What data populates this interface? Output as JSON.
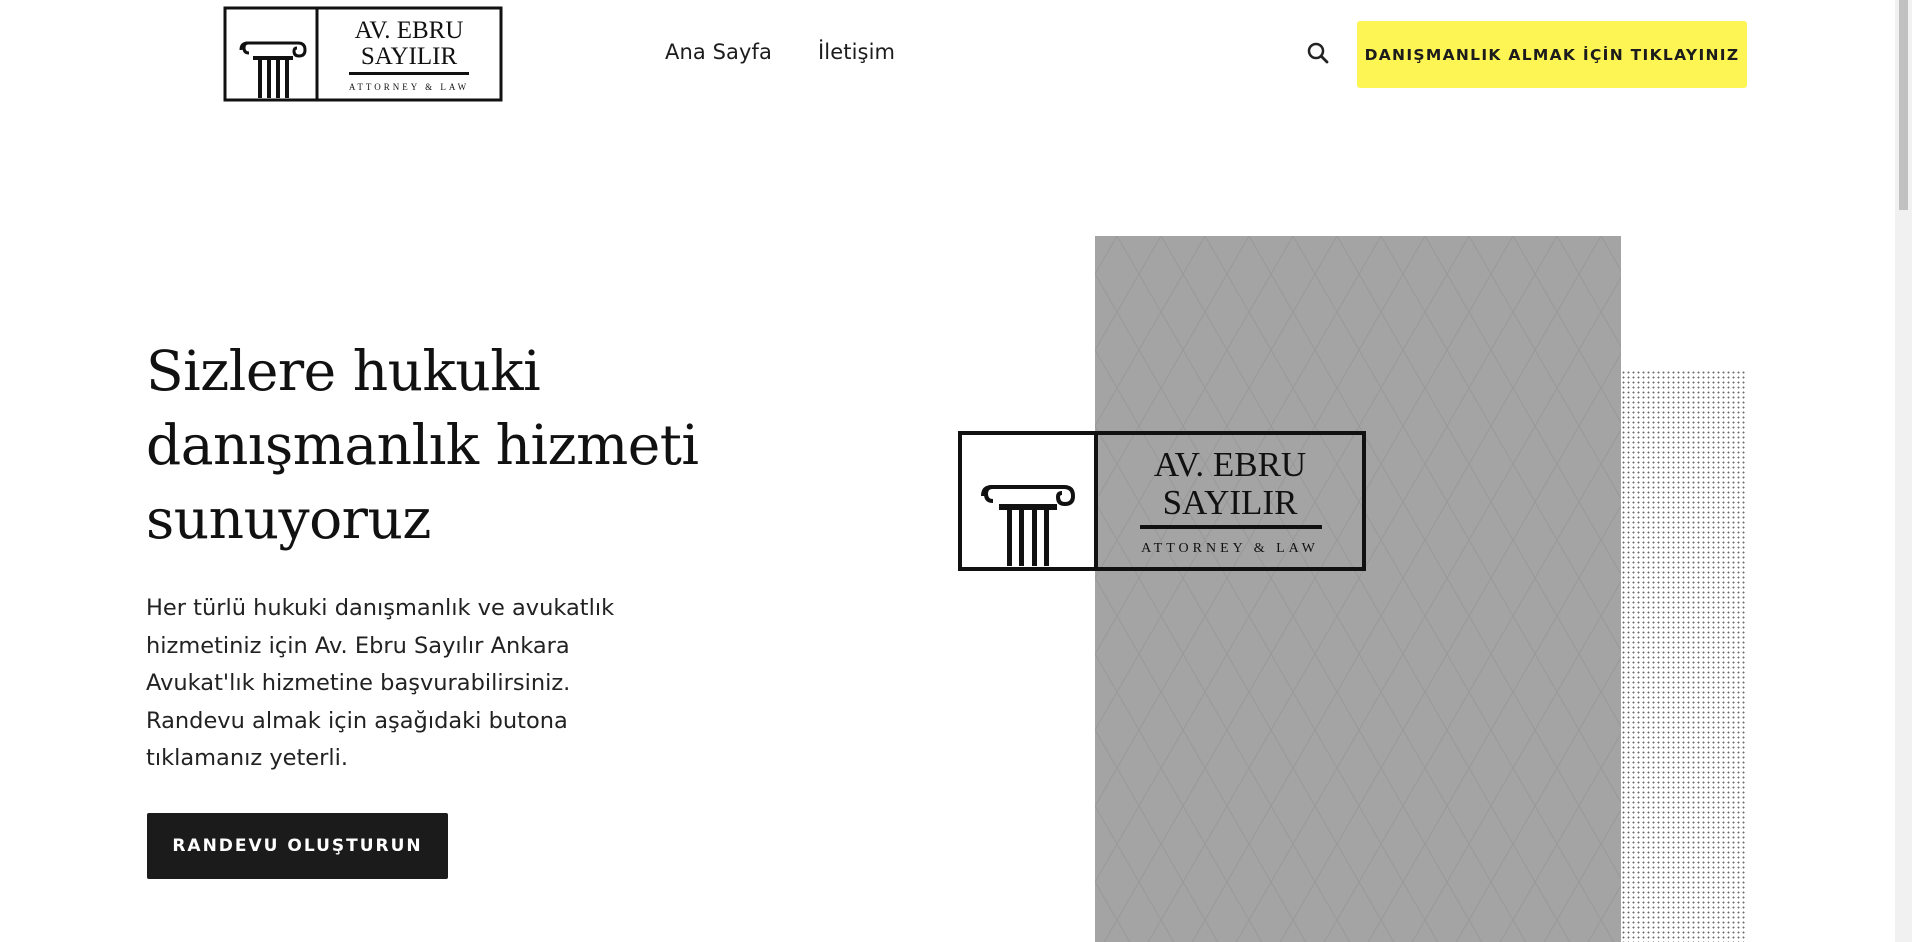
{
  "brand": {
    "name_line1": "AV. EBRU",
    "name_line2": "SAYILIR",
    "tagline": "ATTORNEY & LAW"
  },
  "nav": {
    "items": [
      {
        "label": "Ana Sayfa"
      },
      {
        "label": "İletişim"
      }
    ],
    "search_icon": "search-icon"
  },
  "header": {
    "cta_label": "DANIŞMANLIK ALMAK İÇİN TIKLAYINIZ"
  },
  "hero": {
    "title": "Sizlere hukuki danışmanlık hizmeti sunuyoruz",
    "description": "Her türlü hukuki danışmanlık ve avukatlık hizmetiniz için Av. Ebru Sayılır Ankara Avukat'lık hizmetine başvurabilirsiniz. Randevu almak için aşağıdaki butona tıklamanız yeterli.",
    "button_label": "RANDEVU OLUŞTURUN"
  },
  "colors": {
    "cta_yellow": "#fdf553",
    "dark_button": "#1b1b1b",
    "panel_gray": "#a4a4a4"
  }
}
